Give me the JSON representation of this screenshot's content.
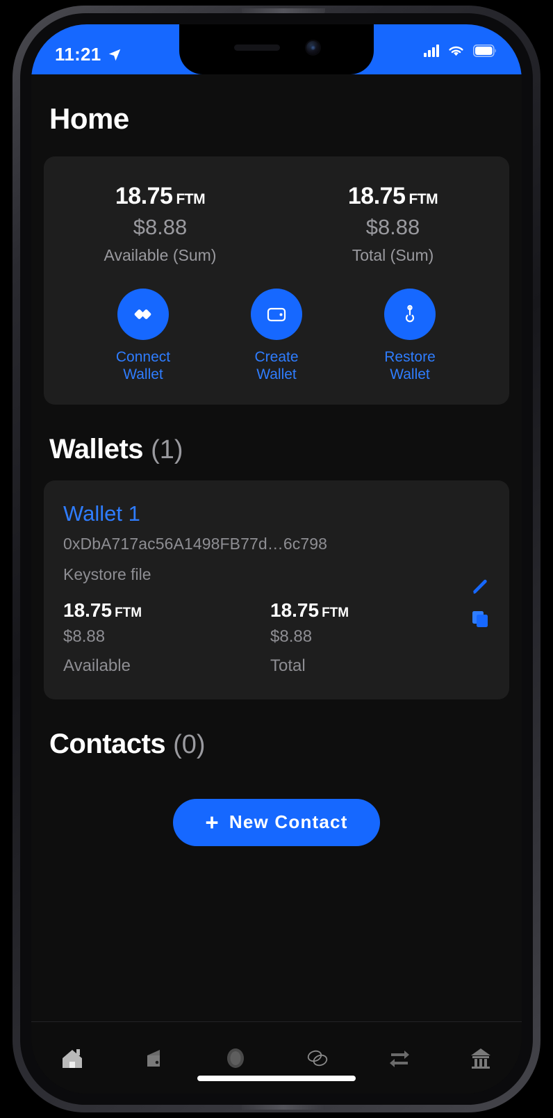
{
  "status_bar": {
    "time": "11:21",
    "location_icon": "location-arrow-icon",
    "signal_icon": "cellular-signal-icon",
    "wifi_icon": "wifi-icon",
    "battery_icon": "battery-icon",
    "background_color": "#1668ff"
  },
  "header": {
    "title": "Home"
  },
  "summary_card": {
    "available": {
      "amount": "18.75",
      "unit": "FTM",
      "fiat": "$8.88",
      "label": "Available (Sum)"
    },
    "total": {
      "amount": "18.75",
      "unit": "FTM",
      "fiat": "$8.88",
      "label": "Total (Sum)"
    },
    "actions": [
      {
        "icon": "connect-wallet-icon",
        "label_line1": "Connect",
        "label_line2": "Wallet"
      },
      {
        "icon": "create-wallet-icon",
        "label_line1": "Create",
        "label_line2": "Wallet"
      },
      {
        "icon": "restore-wallet-icon",
        "label_line1": "Restore",
        "label_line2": "Wallet"
      }
    ]
  },
  "wallets_section": {
    "title": "Wallets",
    "count": "(1)",
    "wallet": {
      "name": "Wallet 1",
      "address": "0xDbA717ac56A1498FB77d…6c798",
      "type": "Keystore file",
      "available": {
        "amount": "18.75",
        "unit": "FTM",
        "fiat": "$8.88",
        "label": "Available"
      },
      "total": {
        "amount": "18.75",
        "unit": "FTM",
        "fiat": "$8.88",
        "label": "Total"
      },
      "edit_icon": "pencil-edit-icon",
      "copy_icon": "copy-icon"
    }
  },
  "contacts_section": {
    "title": "Contacts",
    "count": "(0)",
    "new_contact_button": {
      "plus": "+",
      "label": "New Contact"
    }
  },
  "tab_bar": {
    "items": [
      {
        "name": "tab-home",
        "icon": "home-icon",
        "active": true
      },
      {
        "name": "tab-wallet",
        "icon": "wallet-icon",
        "active": false
      },
      {
        "name": "tab-token",
        "icon": "token-icon",
        "active": false
      },
      {
        "name": "tab-staking",
        "icon": "coins-icon",
        "active": false
      },
      {
        "name": "tab-swap",
        "icon": "swap-arrows-icon",
        "active": false
      },
      {
        "name": "tab-governance",
        "icon": "bank-icon",
        "active": false
      }
    ]
  },
  "theme": {
    "accent": "#1668ff",
    "link": "#2f7dff",
    "background": "#0e0e0e",
    "card": "#1e1e1e",
    "muted_text": "#8e8e93"
  }
}
